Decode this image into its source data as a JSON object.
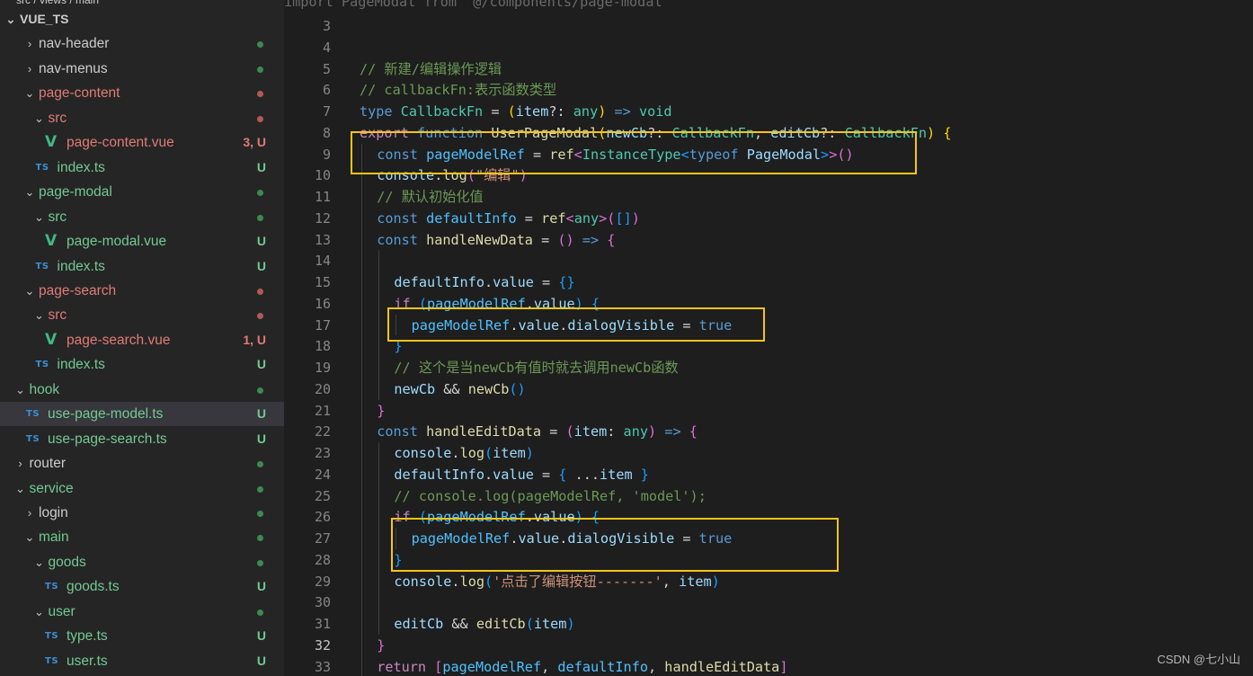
{
  "explorer": {
    "truncated_top_text": "src / views / main",
    "rows": [
      {
        "label": "VUE_TS",
        "kind": "root",
        "chev": "⌄",
        "indent": 0,
        "badge": "",
        "dot": ""
      },
      {
        "label": "nav-header",
        "kind": "folder",
        "chev": "›",
        "indent": 2,
        "badge": "",
        "dot": "#3c8a4f",
        "color": "#cccccc"
      },
      {
        "label": "nav-menus",
        "kind": "folder",
        "chev": "›",
        "indent": 2,
        "badge": "",
        "dot": "#3c8a4f",
        "color": "#cccccc"
      },
      {
        "label": "page-content",
        "kind": "folder",
        "chev": "⌄",
        "indent": 2,
        "badge": "",
        "dot": "#b35a55",
        "color": "#e07b73"
      },
      {
        "label": "src",
        "kind": "folder",
        "chev": "⌄",
        "indent": 3,
        "badge": "",
        "dot": "#b35a55",
        "color": "#e07b73"
      },
      {
        "label": "page-content.vue",
        "kind": "vue",
        "chev": "",
        "indent": 4,
        "badge": "3, U",
        "dot": "",
        "color": "#e07b73",
        "badge_color": "#e07b73"
      },
      {
        "label": "index.ts",
        "kind": "ts",
        "chev": "",
        "indent": 3,
        "badge": "U",
        "dot": "",
        "color": "#73c991",
        "badge_color": "#73c991"
      },
      {
        "label": "page-modal",
        "kind": "folder",
        "chev": "⌄",
        "indent": 2,
        "badge": "",
        "dot": "#3c8a4f",
        "color": "#73c991"
      },
      {
        "label": "src",
        "kind": "folder",
        "chev": "⌄",
        "indent": 3,
        "badge": "",
        "dot": "#3c8a4f",
        "color": "#73c991"
      },
      {
        "label": "page-modal.vue",
        "kind": "vue",
        "chev": "",
        "indent": 4,
        "badge": "U",
        "dot": "",
        "color": "#73c991",
        "badge_color": "#73c991"
      },
      {
        "label": "index.ts",
        "kind": "ts",
        "chev": "",
        "indent": 3,
        "badge": "U",
        "dot": "",
        "color": "#73c991",
        "badge_color": "#73c991"
      },
      {
        "label": "page-search",
        "kind": "folder",
        "chev": "⌄",
        "indent": 2,
        "badge": "",
        "dot": "#b35a55",
        "color": "#e07b73"
      },
      {
        "label": "src",
        "kind": "folder",
        "chev": "⌄",
        "indent": 3,
        "badge": "",
        "dot": "#b35a55",
        "color": "#e07b73"
      },
      {
        "label": "page-search.vue",
        "kind": "vue",
        "chev": "",
        "indent": 4,
        "badge": "1, U",
        "dot": "",
        "color": "#e07b73",
        "badge_color": "#e07b73"
      },
      {
        "label": "index.ts",
        "kind": "ts",
        "chev": "",
        "indent": 3,
        "badge": "U",
        "dot": "",
        "color": "#73c991",
        "badge_color": "#73c991"
      },
      {
        "label": "hook",
        "kind": "folder",
        "chev": "⌄",
        "indent": 1,
        "badge": "",
        "dot": "#3c8a4f",
        "color": "#73c991"
      },
      {
        "label": "use-page-model.ts",
        "kind": "ts",
        "chev": "",
        "indent": 2,
        "badge": "U",
        "dot": "",
        "color": "#73c991",
        "badge_color": "#73c991",
        "active": true
      },
      {
        "label": "use-page-search.ts",
        "kind": "ts",
        "chev": "",
        "indent": 2,
        "badge": "U",
        "dot": "",
        "color": "#73c991",
        "badge_color": "#73c991"
      },
      {
        "label": "router",
        "kind": "folder",
        "chev": "›",
        "indent": 1,
        "badge": "",
        "dot": "#3c8a4f",
        "color": "#cccccc"
      },
      {
        "label": "service",
        "kind": "folder",
        "chev": "⌄",
        "indent": 1,
        "badge": "",
        "dot": "#3c8a4f",
        "color": "#73c991"
      },
      {
        "label": "login",
        "kind": "folder",
        "chev": "›",
        "indent": 2,
        "badge": "",
        "dot": "#3c8a4f",
        "color": "#cccccc"
      },
      {
        "label": "main",
        "kind": "folder",
        "chev": "⌄",
        "indent": 2,
        "badge": "",
        "dot": "#3c8a4f",
        "color": "#73c991"
      },
      {
        "label": "goods",
        "kind": "folder",
        "chev": "⌄",
        "indent": 3,
        "badge": "",
        "dot": "#3c8a4f",
        "color": "#73c991"
      },
      {
        "label": "goods.ts",
        "kind": "ts",
        "chev": "",
        "indent": 4,
        "badge": "U",
        "dot": "",
        "color": "#73c991",
        "badge_color": "#73c991"
      },
      {
        "label": "user",
        "kind": "folder",
        "chev": "⌄",
        "indent": 3,
        "badge": "",
        "dot": "#3c8a4f",
        "color": "#73c991"
      },
      {
        "label": "type.ts",
        "kind": "ts",
        "chev": "",
        "indent": 4,
        "badge": "U",
        "dot": "",
        "color": "#73c991",
        "badge_color": "#73c991"
      },
      {
        "label": "user.ts",
        "kind": "ts",
        "chev": "",
        "indent": 4,
        "badge": "U",
        "dot": "",
        "color": "#73c991",
        "badge_color": "#73c991"
      }
    ]
  },
  "editor": {
    "current_line": 32,
    "top_partial": "import PageModal from '@/components/page-modal'",
    "lines": [
      {
        "n": 3,
        "tokens": []
      },
      {
        "n": 4,
        "tokens": []
      },
      {
        "n": 5,
        "tokens": [
          [
            "cm",
            "// 新建/编辑操作逻辑"
          ]
        ]
      },
      {
        "n": 6,
        "tokens": [
          [
            "cm",
            "// callbackFn:表示函数类型"
          ]
        ]
      },
      {
        "n": 7,
        "tokens": [
          [
            "kw",
            "type"
          ],
          [
            "pn",
            " "
          ],
          [
            "ty",
            "CallbackFn"
          ],
          [
            "pn",
            " = "
          ],
          [
            "br1",
            "("
          ],
          [
            "var",
            "item"
          ],
          [
            "pn",
            "?: "
          ],
          [
            "ty",
            "any"
          ],
          [
            "br1",
            ")"
          ],
          [
            "pn",
            " "
          ],
          [
            "kw",
            "=>"
          ],
          [
            "pn",
            " "
          ],
          [
            "ty",
            "void"
          ]
        ]
      },
      {
        "n": 8,
        "tokens": [
          [
            "kw2",
            "export"
          ],
          [
            "pn",
            " "
          ],
          [
            "kw",
            "function"
          ],
          [
            "pn",
            " "
          ],
          [
            "fn",
            "UserPageModal"
          ],
          [
            "br1",
            "("
          ],
          [
            "var",
            "newCb"
          ],
          [
            "pn",
            "?: "
          ],
          [
            "ty",
            "CallbackFn"
          ],
          [
            "pn",
            ", "
          ],
          [
            "var",
            "editCb"
          ],
          [
            "pn",
            "?: "
          ],
          [
            "ty",
            "CallbackFn"
          ],
          [
            "br1",
            ")"
          ],
          [
            "pn",
            " "
          ],
          [
            "br1",
            "{"
          ]
        ]
      },
      {
        "n": 9,
        "indent": 1,
        "tokens": [
          [
            "kw",
            "const"
          ],
          [
            "pn",
            " "
          ],
          [
            "cn",
            "pageModelRef"
          ],
          [
            "pn",
            " = "
          ],
          [
            "fn",
            "ref"
          ],
          [
            "br2",
            "<"
          ],
          [
            "ty",
            "InstanceType"
          ],
          [
            "br3",
            "<"
          ],
          [
            "kw",
            "typeof"
          ],
          [
            "pn",
            " "
          ],
          [
            "var",
            "PageModal"
          ],
          [
            "br3",
            ">"
          ],
          [
            "br2",
            ">"
          ],
          [
            "br2",
            "()"
          ]
        ]
      },
      {
        "n": 10,
        "indent": 1,
        "tokens": [
          [
            "var",
            "console"
          ],
          [
            "pn",
            "."
          ],
          [
            "fn",
            "log"
          ],
          [
            "br2",
            "("
          ],
          [
            "st",
            "\"编辑\""
          ],
          [
            "br2",
            ")"
          ]
        ]
      },
      {
        "n": 11,
        "indent": 1,
        "tokens": [
          [
            "cm",
            "// 默认初始化值"
          ]
        ]
      },
      {
        "n": 12,
        "indent": 1,
        "tokens": [
          [
            "kw",
            "const"
          ],
          [
            "pn",
            " "
          ],
          [
            "cn",
            "defaultInfo"
          ],
          [
            "pn",
            " = "
          ],
          [
            "fn",
            "ref"
          ],
          [
            "br2",
            "<"
          ],
          [
            "ty",
            "any"
          ],
          [
            "br2",
            ">"
          ],
          [
            "br2",
            "("
          ],
          [
            "br3",
            "[]"
          ],
          [
            "br2",
            ")"
          ]
        ]
      },
      {
        "n": 13,
        "indent": 1,
        "tokens": [
          [
            "kw",
            "const"
          ],
          [
            "pn",
            " "
          ],
          [
            "fn",
            "handleNewData"
          ],
          [
            "pn",
            " = "
          ],
          [
            "br2",
            "()"
          ],
          [
            "pn",
            " "
          ],
          [
            "kw",
            "=>"
          ],
          [
            "pn",
            " "
          ],
          [
            "br2",
            "{"
          ]
        ]
      },
      {
        "n": 14,
        "indent": 2,
        "tokens": []
      },
      {
        "n": 15,
        "indent": 2,
        "tokens": [
          [
            "var",
            "defaultInfo"
          ],
          [
            "pn",
            "."
          ],
          [
            "var",
            "value"
          ],
          [
            "pn",
            " = "
          ],
          [
            "br3",
            "{}"
          ]
        ]
      },
      {
        "n": 16,
        "indent": 2,
        "tokens": [
          [
            "kw2",
            "if"
          ],
          [
            "pn",
            " "
          ],
          [
            "br3",
            "("
          ],
          [
            "cn",
            "pageModelRef"
          ],
          [
            "pn",
            "."
          ],
          [
            "var",
            "value"
          ],
          [
            "br3",
            ")"
          ],
          [
            "pn",
            " "
          ],
          [
            "br3",
            "{"
          ]
        ]
      },
      {
        "n": 17,
        "indent": 3,
        "tokens": [
          [
            "cn",
            "pageModelRef"
          ],
          [
            "pn",
            "."
          ],
          [
            "var",
            "value"
          ],
          [
            "pn",
            "."
          ],
          [
            "var",
            "dialogVisible"
          ],
          [
            "pn",
            " = "
          ],
          [
            "kw",
            "true"
          ]
        ]
      },
      {
        "n": 18,
        "indent": 2,
        "tokens": [
          [
            "br3",
            "}"
          ]
        ]
      },
      {
        "n": 19,
        "indent": 2,
        "tokens": [
          [
            "cm",
            "// 这个是当newCb有值时就去调用newCb函数"
          ]
        ]
      },
      {
        "n": 20,
        "indent": 2,
        "tokens": [
          [
            "var",
            "newCb"
          ],
          [
            "pn",
            " && "
          ],
          [
            "fn",
            "newCb"
          ],
          [
            "br3",
            "()"
          ]
        ]
      },
      {
        "n": 21,
        "indent": 1,
        "tokens": [
          [
            "br2",
            "}"
          ]
        ]
      },
      {
        "n": 22,
        "indent": 1,
        "tokens": [
          [
            "kw",
            "const"
          ],
          [
            "pn",
            " "
          ],
          [
            "fn",
            "handleEditData"
          ],
          [
            "pn",
            " = "
          ],
          [
            "br2",
            "("
          ],
          [
            "var",
            "item"
          ],
          [
            "pn",
            ": "
          ],
          [
            "ty",
            "any"
          ],
          [
            "br2",
            ")"
          ],
          [
            "pn",
            " "
          ],
          [
            "kw",
            "=>"
          ],
          [
            "pn",
            " "
          ],
          [
            "br2",
            "{"
          ]
        ]
      },
      {
        "n": 23,
        "indent": 2,
        "tokens": [
          [
            "var",
            "console"
          ],
          [
            "pn",
            "."
          ],
          [
            "fn",
            "log"
          ],
          [
            "br3",
            "("
          ],
          [
            "var",
            "item"
          ],
          [
            "br3",
            ")"
          ]
        ]
      },
      {
        "n": 24,
        "indent": 2,
        "tokens": [
          [
            "var",
            "defaultInfo"
          ],
          [
            "pn",
            "."
          ],
          [
            "var",
            "value"
          ],
          [
            "pn",
            " = "
          ],
          [
            "br3",
            "{"
          ],
          [
            "pn",
            " ..."
          ],
          [
            "var",
            "item"
          ],
          [
            "pn",
            " "
          ],
          [
            "br3",
            "}"
          ]
        ]
      },
      {
        "n": 25,
        "indent": 2,
        "tokens": [
          [
            "cm",
            "// console.log(pageModelRef, 'model');"
          ]
        ]
      },
      {
        "n": 26,
        "indent": 2,
        "tokens": [
          [
            "kw2",
            "if"
          ],
          [
            "pn",
            " "
          ],
          [
            "br3",
            "("
          ],
          [
            "cn",
            "pageModelRef"
          ],
          [
            "pn",
            "."
          ],
          [
            "var",
            "value"
          ],
          [
            "br3",
            ")"
          ],
          [
            "pn",
            " "
          ],
          [
            "br3",
            "{"
          ]
        ]
      },
      {
        "n": 27,
        "indent": 3,
        "tokens": [
          [
            "cn",
            "pageModelRef"
          ],
          [
            "pn",
            "."
          ],
          [
            "var",
            "value"
          ],
          [
            "pn",
            "."
          ],
          [
            "var",
            "dialogVisible"
          ],
          [
            "pn",
            " = "
          ],
          [
            "kw",
            "true"
          ]
        ]
      },
      {
        "n": 28,
        "indent": 2,
        "tokens": [
          [
            "br3",
            "}"
          ]
        ]
      },
      {
        "n": 29,
        "indent": 2,
        "tokens": [
          [
            "var",
            "console"
          ],
          [
            "pn",
            "."
          ],
          [
            "fn",
            "log"
          ],
          [
            "br3",
            "("
          ],
          [
            "st",
            "'点击了编辑按钮-------'"
          ],
          [
            "pn",
            ", "
          ],
          [
            "var",
            "item"
          ],
          [
            "br3",
            ")"
          ]
        ]
      },
      {
        "n": 30,
        "indent": 2,
        "tokens": []
      },
      {
        "n": 31,
        "indent": 2,
        "tokens": [
          [
            "var",
            "editCb"
          ],
          [
            "pn",
            " && "
          ],
          [
            "fn",
            "editCb"
          ],
          [
            "br3",
            "("
          ],
          [
            "var",
            "item"
          ],
          [
            "br3",
            ")"
          ]
        ]
      },
      {
        "n": 32,
        "indent": 1,
        "tokens": [
          [
            "br2",
            "}"
          ]
        ]
      },
      {
        "n": 33,
        "indent": 1,
        "tokens": [
          [
            "kw2",
            "return"
          ],
          [
            "pn",
            " "
          ],
          [
            "br2",
            "["
          ],
          [
            "cn",
            "pageModelRef"
          ],
          [
            "pn",
            ", "
          ],
          [
            "cn",
            "defaultInfo"
          ],
          [
            "pn",
            ", "
          ],
          [
            "fn",
            "handleEditData"
          ],
          [
            "br2",
            "]"
          ]
        ]
      }
    ],
    "highlight_color": "#f5c518"
  },
  "watermark": "CSDN @七小山"
}
